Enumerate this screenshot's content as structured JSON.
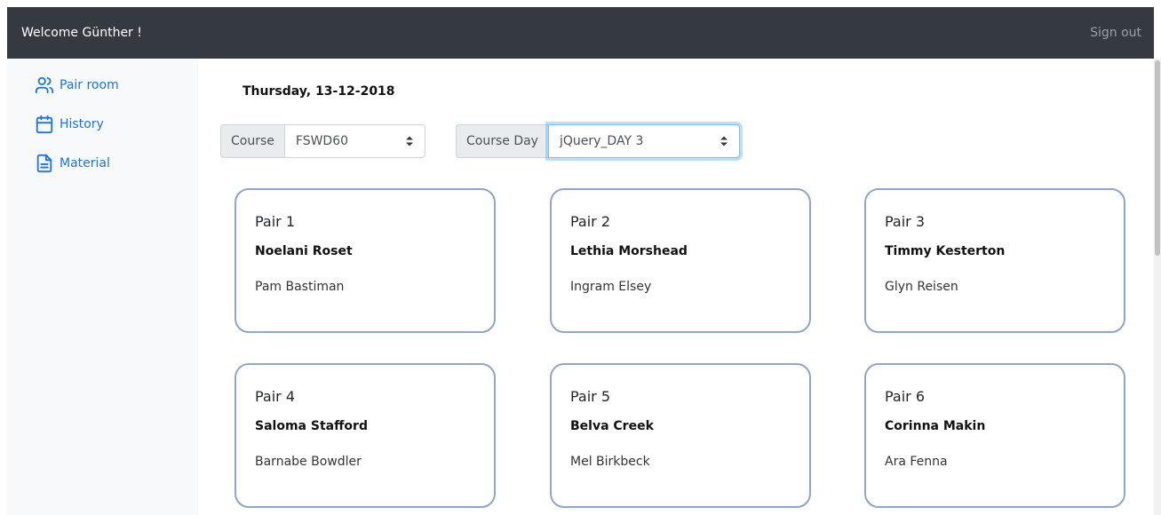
{
  "header": {
    "welcome": "Welcome Günther !",
    "sign_out": "Sign out"
  },
  "sidebar": {
    "items": [
      {
        "label": "Pair room",
        "icon": "users-icon"
      },
      {
        "label": "History",
        "icon": "calendar-icon"
      },
      {
        "label": "Material",
        "icon": "document-icon"
      }
    ]
  },
  "main": {
    "date": "Thursday, 13-12-2018",
    "course": {
      "label": "Course",
      "value": "FSWD60"
    },
    "course_day": {
      "label": "Course Day",
      "value": "jQuery_DAY 3"
    },
    "pairs": [
      {
        "title": "Pair 1",
        "first": "Noelani Roset",
        "second": "Pam Bastiman"
      },
      {
        "title": "Pair 2",
        "first": "Lethia Morshead",
        "second": "Ingram Elsey"
      },
      {
        "title": "Pair 3",
        "first": "Timmy Kesterton",
        "second": "Glyn Reisen"
      },
      {
        "title": "Pair 4",
        "first": "Saloma Stafford",
        "second": "Barnabe Bowdler"
      },
      {
        "title": "Pair 5",
        "first": "Belva Creek",
        "second": "Mel Birkbeck"
      },
      {
        "title": "Pair 6",
        "first": "Corinna Makin",
        "second": "Ara Fenna"
      }
    ]
  },
  "colors": {
    "topbar": "#343a40",
    "link": "#1a73e8",
    "card_border": "#8fa6c8"
  }
}
